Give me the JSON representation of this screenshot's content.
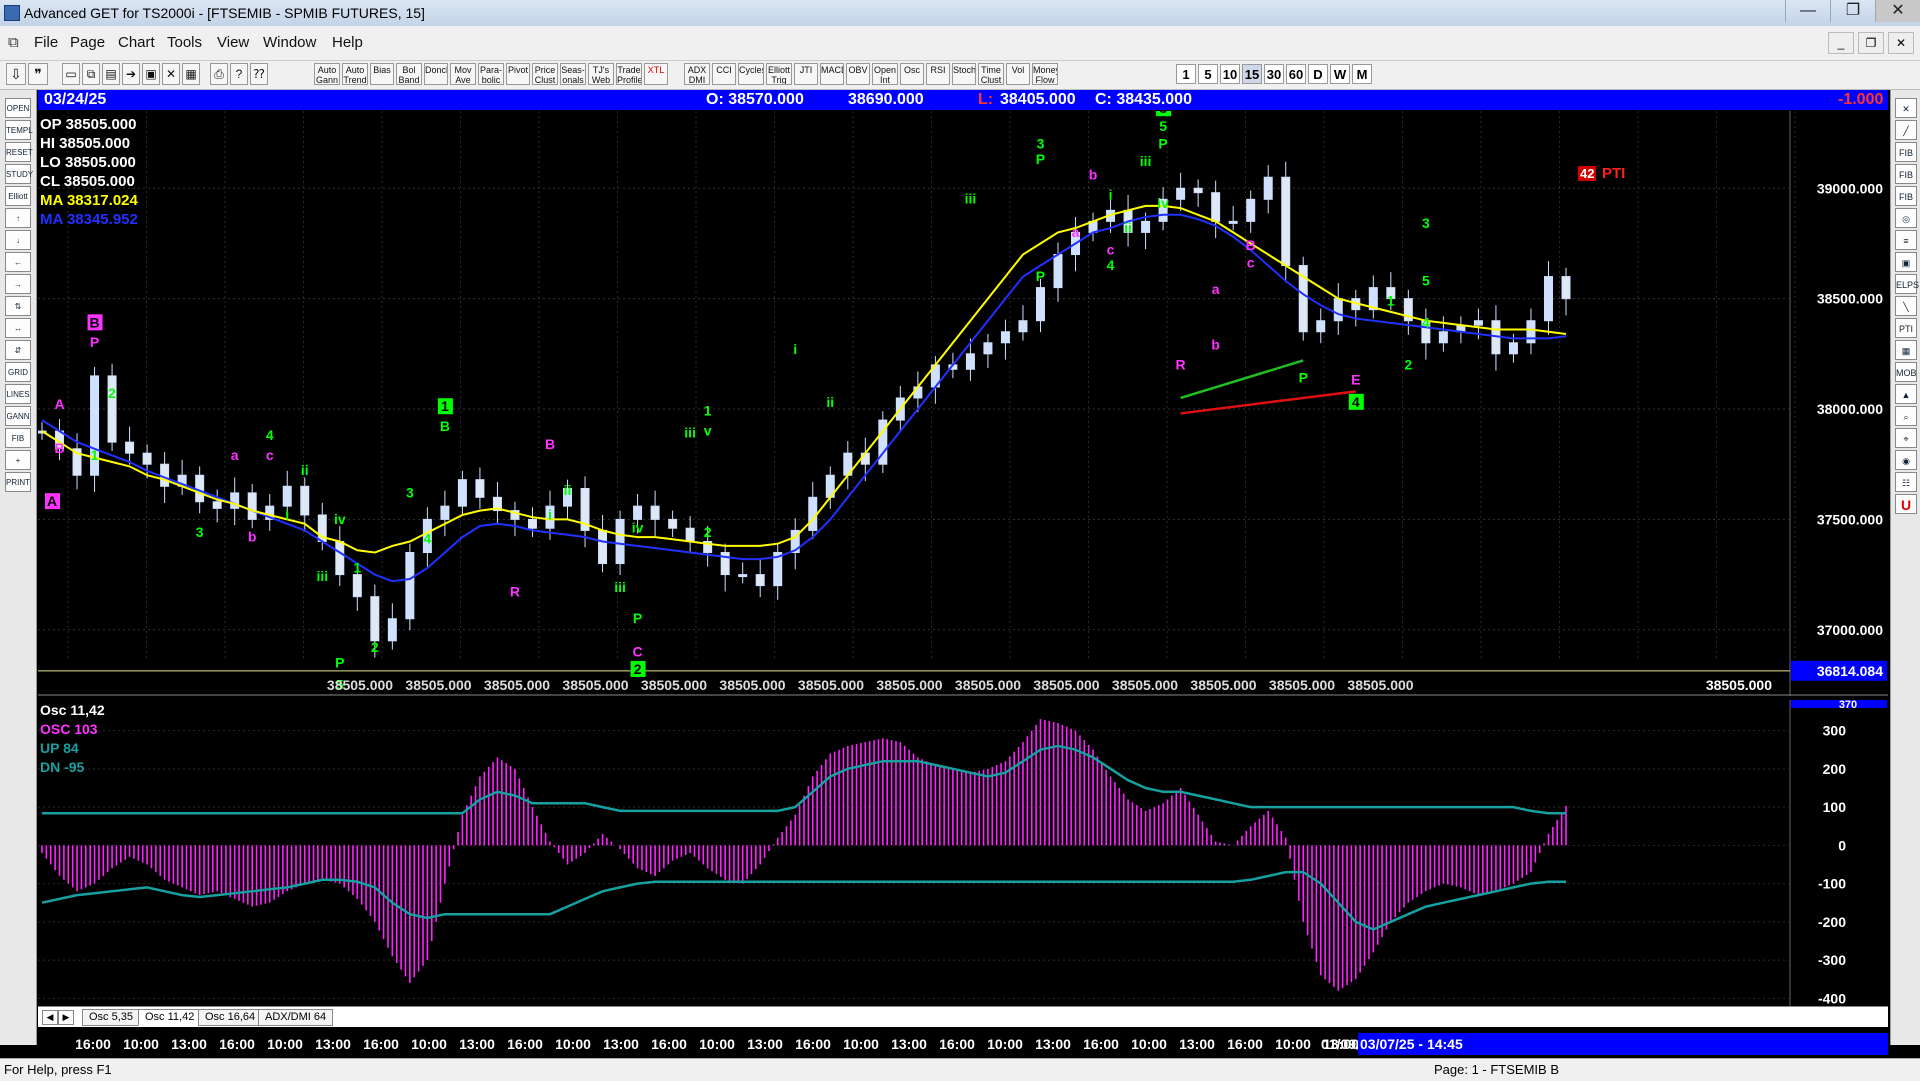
{
  "window": {
    "title": "Advanced GET for TS2000i - [FTSEMIB - SPMIB FUTURES, 15]",
    "min": "—",
    "max": "❐",
    "close": "✕"
  },
  "menu": [
    "File",
    "Page",
    "Chart",
    "Tools",
    "View",
    "Window",
    "Help"
  ],
  "mdi_buttons": [
    "_",
    "❐",
    "✕"
  ],
  "toolbar": {
    "study_buttons": [
      "Auto Gann",
      "Auto Trend",
      "Bias",
      "Bol Band",
      "Donch",
      "Mov Ave",
      "Para-bolic",
      "Pivot",
      "Price Clust",
      "Seas-onals",
      "TJ's Web",
      "Trade Profile",
      "XTL",
      "ADX DMI",
      "CCI",
      "Cycles",
      "Elliott Trig",
      "JTI",
      "MACD",
      "OBV",
      "Open Int",
      "Osc",
      "RSI",
      "Stoch",
      "Time Clust",
      "Vol",
      "Money Flow"
    ],
    "intervals": [
      "1",
      "5",
      "10",
      "15",
      "30",
      "60",
      "D",
      "W",
      "M"
    ],
    "active_interval": "15"
  },
  "left_tools": [
    "OPEN",
    "TEMPL",
    "RESET",
    "STUDY",
    "Elliott",
    "↑",
    "↓",
    "←",
    "→",
    "⇅",
    "↔",
    "⇵",
    "GRID",
    "LINES",
    "GANN",
    "FIB",
    "+",
    "PRINT"
  ],
  "right_tools": [
    "✕",
    "╱",
    "FIB RET",
    "FIB EXT",
    "FIB TIME",
    "◎",
    "≡",
    "▣",
    "ELPS",
    "╲",
    "PTI",
    "▦",
    "MOB",
    "▲",
    "⌕",
    "⌖",
    "◉",
    "☷",
    "U"
  ],
  "infobar": {
    "date": "03/24/25",
    "open": "O: 38570.000",
    "high": "38690.000",
    "low_label": "L:",
    "low": "38405.000",
    "close": "C: 38435.000",
    "change": "-1.000"
  },
  "stats": {
    "op": "OP  38505.000",
    "hi": "HI   38505.000",
    "lo": "LO   38505.000",
    "cl": "CL   38505.000",
    "ma1": "MA  38317.024",
    "ma2": "MA  38345.952"
  },
  "pti": {
    "value": "42",
    "label": "PTI"
  },
  "price_axis": {
    "labels": [
      "39000.000",
      "38500.000",
      "38000.000",
      "37500.000",
      "37000.000"
    ],
    "current_line": "36814.084"
  },
  "bottom_price_labels": [
    "38505.000",
    "38505.000",
    "38505.000",
    "38505.000",
    "38505.000",
    "38505.000",
    "38505.000",
    "38505.000",
    "38505.000",
    "38505.000",
    "38505.000",
    "38505.000",
    "38505.000",
    "38505.000"
  ],
  "osc": {
    "title": "Osc 11,42",
    "osc_line": "OSC 103",
    "up_line": "UP   84",
    "dn_line": "DN   -95",
    "axis_labels": [
      "300",
      "200",
      "100",
      "0",
      "-100",
      "-200",
      "-300",
      "-400"
    ],
    "top_label": "370"
  },
  "tabs": [
    "Osc 5,35",
    "Osc 11,42",
    "Osc 16,64",
    "ADX/DMI 64"
  ],
  "active_tab": "Osc 11,42",
  "time_labels": [
    "16:00",
    "10:00",
    "13:00",
    "16:00",
    "10:00",
    "13:00",
    "16:00",
    "10:00",
    "13:00",
    "16:00",
    "10:00",
    "13:00",
    "16:00",
    "10:00",
    "13:00",
    "16:00",
    "10:00",
    "13:00",
    "16:00",
    "10:00",
    "13:00",
    "16:00",
    "10:00",
    "13:00",
    "16:00",
    "10:00",
    "13:00",
    "16:00",
    "10:00",
    "13:00",
    "16:00",
    "01/09/01"
  ],
  "time_current": "03/07/25 - 14:45",
  "status": {
    "left": "For Help, press F1",
    "right": "Page: 1 - FTSEMIB B"
  },
  "colors": {
    "bg": "#000000",
    "candle": "#cfe1ff",
    "ma_fast": "#ffff00",
    "ma_slow": "#2030ff",
    "osc": "#ff22ff",
    "band": "#17a0a0",
    "wave_green": "#00ff00",
    "wave_magenta": "#ff33ff",
    "infobar": "#0000ff"
  },
  "chart_data": [
    {
      "type": "candlestick",
      "ylim": [
        36700,
        39350
      ],
      "price_series": [
        37900,
        37820,
        37700,
        38150,
        37850,
        37800,
        37750,
        37650,
        37700,
        37580,
        37550,
        37620,
        37500,
        37560,
        37650,
        37520,
        37400,
        37250,
        37150,
        36950,
        37050,
        37350,
        37500,
        37560,
        37680,
        37600,
        37540,
        37500,
        37460,
        37560,
        37640,
        37450,
        37300,
        37500,
        37560,
        37500,
        37460,
        37400,
        37350,
        37250,
        37250,
        37200,
        37350,
        37450,
        37600,
        37700,
        37800,
        37750,
        37950,
        38050,
        38100,
        38200,
        38180,
        38250,
        38300,
        38350,
        38400,
        38550,
        38700,
        38800,
        38850,
        38900,
        38800,
        38850,
        38950,
        39000,
        38980,
        38850,
        38850,
        38950,
        39050,
        38650,
        38350,
        38400,
        38500,
        38450,
        38550,
        38500,
        38400,
        38300,
        38350,
        38380,
        38400,
        38250,
        38300,
        38400,
        38600,
        38500
      ],
      "ma_fast_series": [
        37900,
        37850,
        37800,
        37780,
        37760,
        37740,
        37700,
        37680,
        37650,
        37620,
        37590,
        37570,
        37540,
        37520,
        37500,
        37480,
        37420,
        37400,
        37360,
        37350,
        37380,
        37400,
        37440,
        37480,
        37520,
        37540,
        37550,
        37530,
        37510,
        37500,
        37500,
        37480,
        37450,
        37430,
        37420,
        37420,
        37410,
        37400,
        37390,
        37380,
        37380,
        37380,
        37390,
        37420,
        37500,
        37600,
        37700,
        37800,
        37900,
        38000,
        38100,
        38200,
        38300,
        38400,
        38500,
        38600,
        38700,
        38750,
        38800,
        38820,
        38850,
        38880,
        38900,
        38920,
        38920,
        38910,
        38880,
        38850,
        38800,
        38750,
        38700,
        38650,
        38600,
        38550,
        38500,
        38480,
        38460,
        38440,
        38420,
        38400,
        38390,
        38380,
        38370,
        38360,
        38360,
        38360,
        38350,
        38340
      ],
      "ma_slow_series": [
        37950,
        37900,
        37850,
        37820,
        37790,
        37760,
        37720,
        37690,
        37660,
        37630,
        37600,
        37570,
        37540,
        37510,
        37480,
        37450,
        37400,
        37350,
        37300,
        37250,
        37220,
        37230,
        37280,
        37350,
        37420,
        37470,
        37480,
        37470,
        37450,
        37440,
        37430,
        37420,
        37400,
        37390,
        37380,
        37370,
        37360,
        37350,
        37340,
        37330,
        37320,
        37320,
        37330,
        37360,
        37420,
        37500,
        37600,
        37700,
        37800,
        37900,
        38000,
        38100,
        38200,
        38300,
        38400,
        38500,
        38600,
        38650,
        38700,
        38750,
        38800,
        38820,
        38850,
        38870,
        38880,
        38880,
        38860,
        38830,
        38780,
        38720,
        38650,
        38580,
        38520,
        38470,
        38430,
        38410,
        38400,
        38390,
        38380,
        38370,
        38360,
        38350,
        38340,
        38330,
        38320,
        38320,
        38320,
        38330
      ]
    },
    {
      "type": "bar",
      "ylim": [
        -420,
        380
      ],
      "values": [
        -20,
        -80,
        -120,
        -100,
        -60,
        -30,
        -50,
        -90,
        -110,
        -130,
        -120,
        -140,
        -160,
        -150,
        -120,
        -100,
        -90,
        -100,
        -140,
        -200,
        -290,
        -360,
        -300,
        -100,
        80,
        180,
        230,
        200,
        100,
        10,
        -50,
        -20,
        30,
        -10,
        -60,
        -80,
        -40,
        -20,
        -60,
        -90,
        -100,
        -50,
        20,
        80,
        180,
        240,
        260,
        270,
        280,
        270,
        230,
        210,
        200,
        190,
        200,
        220,
        270,
        330,
        320,
        300,
        250,
        180,
        120,
        90,
        110,
        150,
        80,
        10,
        0,
        50,
        90,
        20,
        -200,
        -340,
        -380,
        -350,
        -280,
        -200,
        -150,
        -120,
        -100,
        -110,
        -130,
        -120,
        -100,
        -70,
        30,
        103
      ],
      "up_band": [
        84,
        84,
        84,
        84,
        84,
        84,
        84,
        84,
        84,
        84,
        84,
        84,
        84,
        84,
        84,
        84,
        84,
        84,
        84,
        84,
        84,
        84,
        84,
        84,
        84,
        120,
        140,
        130,
        110,
        110,
        110,
        110,
        100,
        90,
        90,
        90,
        90,
        90,
        90,
        90,
        90,
        90,
        90,
        100,
        140,
        180,
        200,
        210,
        220,
        220,
        220,
        210,
        200,
        190,
        180,
        190,
        220,
        250,
        260,
        250,
        230,
        200,
        170,
        150,
        140,
        140,
        130,
        120,
        110,
        100,
        100,
        100,
        100,
        100,
        100,
        100,
        100,
        100,
        100,
        100,
        100,
        100,
        100,
        100,
        100,
        90,
        84,
        84
      ],
      "dn_band": [
        -150,
        -140,
        -130,
        -125,
        -120,
        -115,
        -110,
        -120,
        -130,
        -135,
        -130,
        -125,
        -120,
        -115,
        -110,
        -100,
        -90,
        -90,
        -95,
        -110,
        -150,
        -180,
        -190,
        -180,
        -180,
        -180,
        -180,
        -180,
        -180,
        -180,
        -160,
        -140,
        -120,
        -110,
        -100,
        -95,
        -95,
        -95,
        -95,
        -95,
        -95,
        -95,
        -95,
        -95,
        -95,
        -95,
        -95,
        -95,
        -95,
        -95,
        -95,
        -95,
        -95,
        -95,
        -95,
        -95,
        -95,
        -95,
        -95,
        -95,
        -95,
        -95,
        -95,
        -95,
        -95,
        -95,
        -95,
        -95,
        -95,
        -90,
        -80,
        -70,
        -70,
        -100,
        -150,
        -200,
        -220,
        -200,
        -180,
        -160,
        -150,
        -140,
        -130,
        -120,
        -110,
        -100,
        -95,
        -95
      ]
    }
  ],
  "wave_labels": [
    {
      "t": "A",
      "i": 0,
      "p": 37560,
      "c": "m",
      "box": true
    },
    {
      "t": "A",
      "i": 1,
      "p": 38000,
      "c": "m"
    },
    {
      "t": "B",
      "i": 1,
      "p": 37800,
      "c": "m"
    },
    {
      "t": "B",
      "i": 3,
      "p": 38370,
      "c": "m",
      "box": true
    },
    {
      "t": "P",
      "i": 3,
      "p": 38280,
      "c": "m"
    },
    {
      "t": "2",
      "i": 4,
      "p": 38050,
      "c": "g"
    },
    {
      "t": "1",
      "i": 3,
      "p": 37770,
      "c": "g"
    },
    {
      "t": "3",
      "i": 9,
      "p": 37420,
      "c": "g"
    },
    {
      "t": "a",
      "i": 11,
      "p": 37770,
      "c": "m"
    },
    {
      "t": "b",
      "i": 12,
      "p": 37400,
      "c": "m"
    },
    {
      "t": "4",
      "i": 13,
      "p": 37860,
      "c": "g"
    },
    {
      "t": "c",
      "i": 13,
      "p": 37770,
      "c": "m"
    },
    {
      "t": "ii",
      "i": 15,
      "p": 37700,
      "c": "g"
    },
    {
      "t": "i",
      "i": 14,
      "p": 37500,
      "c": "g"
    },
    {
      "t": "iv",
      "i": 17,
      "p": 37480,
      "c": "g"
    },
    {
      "t": "iii",
      "i": 16,
      "p": 37220,
      "c": "g"
    },
    {
      "t": "1",
      "i": 18,
      "p": 37260,
      "c": "g"
    },
    {
      "t": "2",
      "i": 19,
      "p": 36900,
      "c": "g"
    },
    {
      "t": "P",
      "i": 17,
      "p": 36830,
      "c": "g"
    },
    {
      "t": "5",
      "i": 17,
      "p": 36730,
      "c": "g"
    },
    {
      "t": "C",
      "i": 17,
      "p": 36640,
      "c": "m",
      "box": true
    },
    {
      "t": "3",
      "i": 21,
      "p": 37600,
      "c": "g"
    },
    {
      "t": "4",
      "i": 22,
      "p": 37390,
      "c": "g"
    },
    {
      "t": "1",
      "i": 23,
      "p": 37990,
      "c": "g",
      "box": true
    },
    {
      "t": "B",
      "i": 23,
      "p": 37900,
      "c": "g"
    },
    {
      "t": "R",
      "i": 27,
      "p": 37150,
      "c": "m"
    },
    {
      "t": "B",
      "i": 29,
      "p": 37820,
      "c": "m"
    },
    {
      "t": "ii",
      "i": 30,
      "p": 37610,
      "c": "g"
    },
    {
      "t": "i",
      "i": 29,
      "p": 37500,
      "c": "g"
    },
    {
      "t": "iv",
      "i": 34,
      "p": 37440,
      "c": "g"
    },
    {
      "t": "iii",
      "i": 33,
      "p": 37170,
      "c": "g"
    },
    {
      "t": "P",
      "i": 34,
      "p": 37030,
      "c": "g"
    },
    {
      "t": "C",
      "i": 34,
      "p": 36880,
      "c": "m"
    },
    {
      "t": "2",
      "i": 34,
      "p": 36800,
      "c": "g",
      "box": true
    },
    {
      "t": "iii",
      "i": 37,
      "p": 37870,
      "c": "g"
    },
    {
      "t": "1",
      "i": 38,
      "p": 37970,
      "c": "g"
    },
    {
      "t": "v",
      "i": 38,
      "p": 37880,
      "c": "g"
    },
    {
      "t": "2",
      "i": 38,
      "p": 37420,
      "c": "g"
    },
    {
      "t": "i",
      "i": 43,
      "p": 38250,
      "c": "g"
    },
    {
      "t": "ii",
      "i": 45,
      "p": 38010,
      "c": "g"
    },
    {
      "t": "iii",
      "i": 53,
      "p": 38930,
      "c": "g"
    },
    {
      "t": "3",
      "i": 57,
      "p": 39180,
      "c": "g"
    },
    {
      "t": "P",
      "i": 57,
      "p": 39110,
      "c": "g"
    },
    {
      "t": "P",
      "i": 57,
      "p": 38580,
      "c": "g"
    },
    {
      "t": "b",
      "i": 60,
      "p": 39040,
      "c": "m"
    },
    {
      "t": "a",
      "i": 59,
      "p": 38780,
      "c": "m"
    },
    {
      "t": "i",
      "i": 61,
      "p": 38950,
      "c": "g"
    },
    {
      "t": "c",
      "i": 61,
      "p": 38700,
      "c": "m"
    },
    {
      "t": "4",
      "i": 61,
      "p": 38630,
      "c": "g"
    },
    {
      "t": "ii",
      "i": 62,
      "p": 38800,
      "c": "g"
    },
    {
      "t": "iii",
      "i": 63,
      "p": 39100,
      "c": "g"
    },
    {
      "t": "iv",
      "i": 64,
      "p": 38910,
      "c": "g"
    },
    {
      "t": "3",
      "i": 64,
      "p": 39340,
      "c": "g",
      "box": true
    },
    {
      "t": "5",
      "i": 64,
      "p": 39260,
      "c": "g"
    },
    {
      "t": "P",
      "i": 64,
      "p": 39180,
      "c": "g"
    },
    {
      "t": "a",
      "i": 67,
      "p": 38520,
      "c": "m"
    },
    {
      "t": "R",
      "i": 65,
      "p": 38180,
      "c": "m"
    },
    {
      "t": "b",
      "i": 67,
      "p": 38270,
      "c": "m"
    },
    {
      "t": "B",
      "i": 69,
      "p": 38720,
      "c": "m"
    },
    {
      "t": "c",
      "i": 69,
      "p": 38640,
      "c": "m"
    },
    {
      "t": "P",
      "i": 72,
      "p": 38120,
      "c": "g"
    },
    {
      "t": "E",
      "i": 75,
      "p": 38110,
      "c": "m"
    },
    {
      "t": "4",
      "i": 75,
      "p": 38010,
      "c": "g",
      "box": true
    },
    {
      "t": "1",
      "i": 77,
      "p": 38470,
      "c": "g"
    },
    {
      "t": "2",
      "i": 78,
      "p": 38180,
      "c": "g"
    },
    {
      "t": "3",
      "i": 79,
      "p": 38820,
      "c": "g"
    },
    {
      "t": "5",
      "i": 79,
      "p": 38560,
      "c": "g"
    },
    {
      "t": "4",
      "i": 79,
      "p": 38370,
      "c": "g"
    }
  ]
}
